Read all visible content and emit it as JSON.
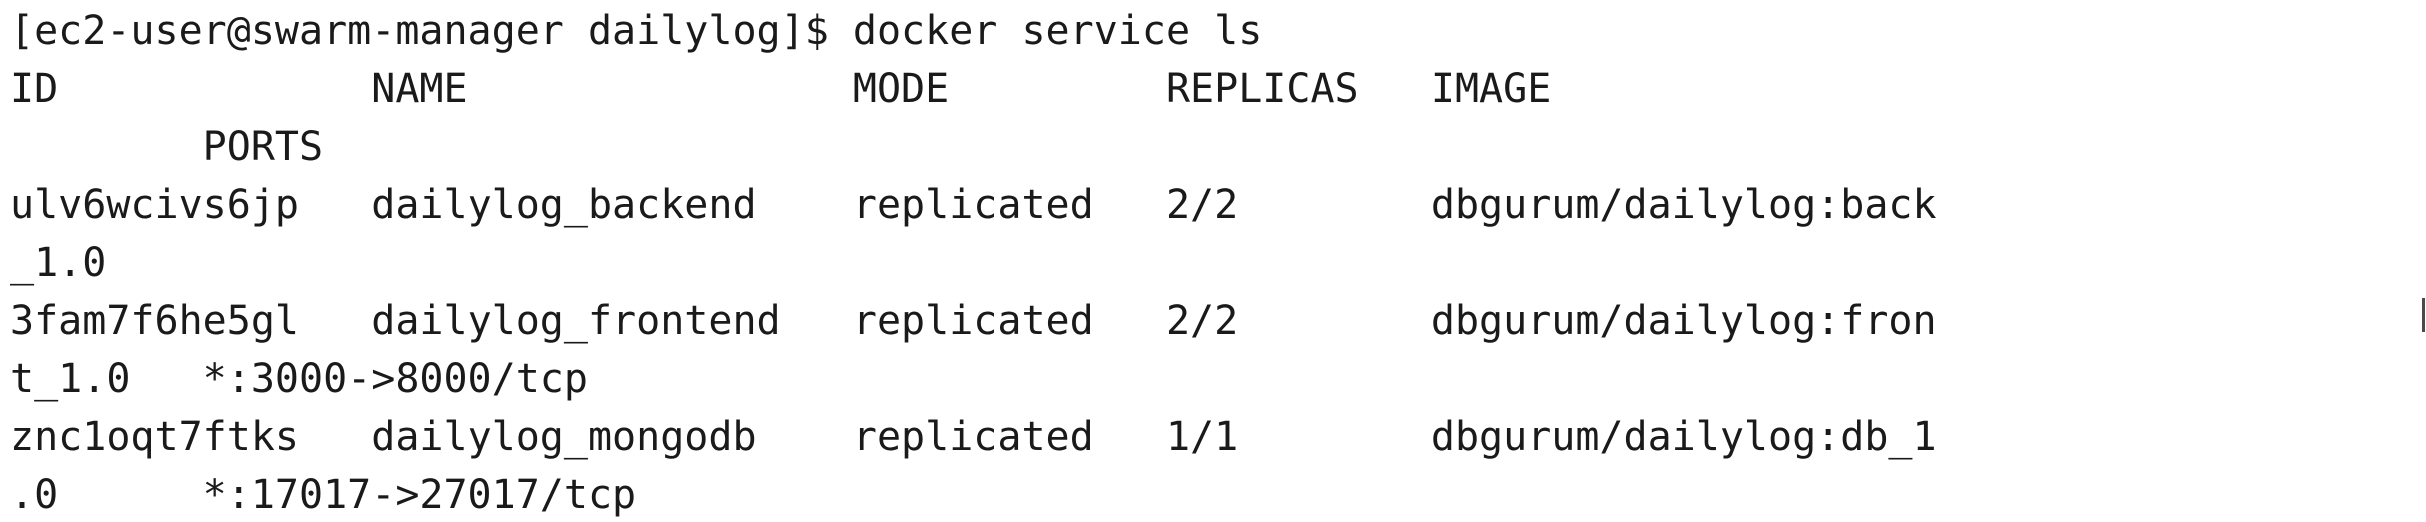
{
  "terminal": {
    "prompt": "[ec2-user@swarm-manager dailylog]$ ",
    "command": "docker service ls",
    "header": {
      "id": "ID",
      "name": "NAME",
      "mode": "MODE",
      "replicas": "REPLICAS",
      "image": "IMAGE",
      "ports": "PORTS"
    },
    "rows": [
      {
        "id": "ulv6wcivs6jp",
        "name": "dailylog_backend",
        "mode": "replicated",
        "replicas": "2/2",
        "image_line1": "dbgurum/dailylog:back",
        "image_line2": "_1.0",
        "ports": ""
      },
      {
        "id": "3fam7f6he5gl",
        "name": "dailylog_frontend",
        "mode": "replicated",
        "replicas": "2/2",
        "image_line1": "dbgurum/dailylog:fron",
        "image_line2": "t_1.0",
        "ports": "*:3000->8000/tcp"
      },
      {
        "id": "znc1oqt7ftks",
        "name": "dailylog_mongodb",
        "mode": "replicated",
        "replicas": "1/1",
        "image_line1": "dbgurum/dailylog:db_1",
        "image_line2": ".0",
        "ports": "*:17017->27017/tcp"
      }
    ]
  }
}
